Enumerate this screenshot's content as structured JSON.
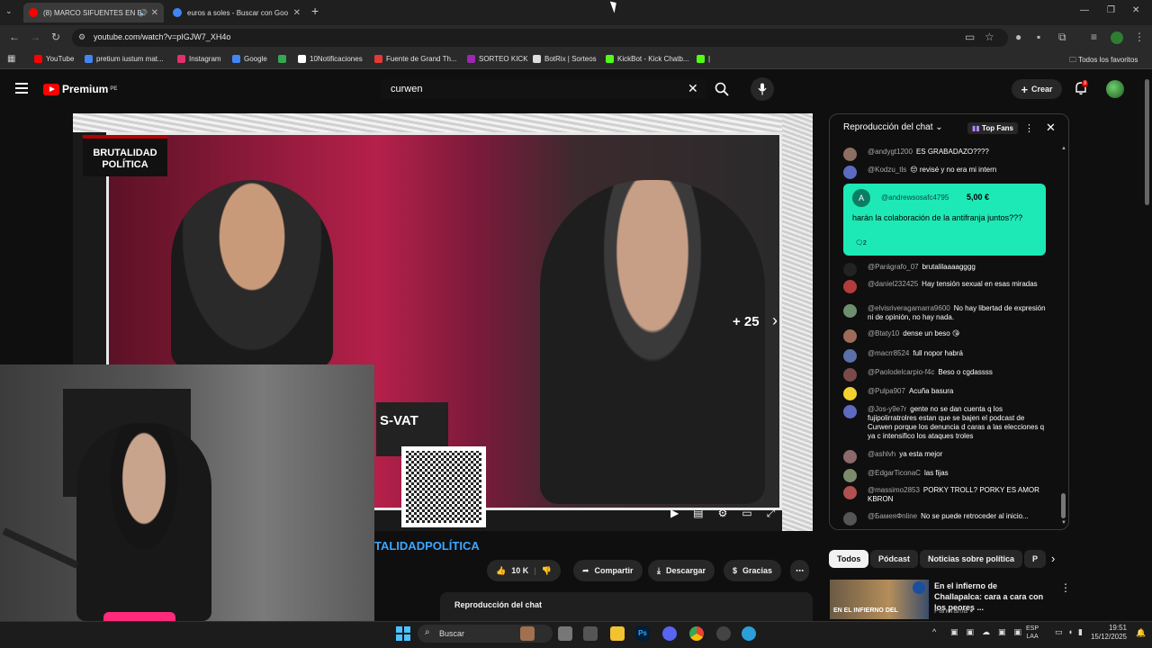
{
  "browser": {
    "tabs": [
      {
        "label": "(8) MARCO SIFUENTES EN B",
        "favicon_color": "#ff0000"
      },
      {
        "label": "euros a soles - Buscar con Goo",
        "favicon_color": "#4285f4"
      }
    ],
    "new_tab": "+",
    "url": "youtube.com/watch?v=pIGJW7_XH4o",
    "bookmarks": [
      {
        "label": "YouTube",
        "color": "#ff0000"
      },
      {
        "label": "pretium iustum mat...",
        "color": "#4285f4"
      },
      {
        "label": "Instagram",
        "color": "#e1306c"
      },
      {
        "label": "Google",
        "color": "#4285f4"
      },
      {
        "label": "",
        "color": "#34a853"
      },
      {
        "label": "10Notificaciones",
        "color": "#ffffff"
      },
      {
        "label": "Fuente de Grand Th...",
        "color": "#e53935"
      },
      {
        "label": "SORTEO KICK",
        "color": "#9c27b0"
      },
      {
        "label": "BotRix | Sorteos",
        "color": "#dddddd"
      },
      {
        "label": "KickBot - Kick Chatb...",
        "color": "#53fc18"
      },
      {
        "label": "|",
        "color": "#53fc18"
      }
    ],
    "all_favorites": "Todos los favoritos"
  },
  "youtube": {
    "logo_text": "Premium",
    "logo_region": "PE",
    "search_value": "curwen",
    "create_label": "Crear",
    "notification_count": "8"
  },
  "video": {
    "logo_text": "BRUTALIDAD POLÍTICA",
    "plus_count": "+ 25",
    "vat_text": "S-VAT"
  },
  "below_video": {
    "channel_name": "TALIDADPOLÍTICA",
    "likes": "10 K",
    "share": "Compartir",
    "download": "Descargar",
    "thanks": "Gracias",
    "chat_replay_title": "Reproducción del chat"
  },
  "chat": {
    "header": "Reproducción del chat",
    "top_fans": "Top Fans",
    "messages_top": [
      {
        "author": "@andygt1200",
        "text": "ES GRABADAZO????",
        "color": "#8d6e63"
      },
      {
        "author": "@Kodzu_tls",
        "text": "😔 revisé y no era mi intern",
        "color": "#5c6bc0"
      }
    ],
    "superchat": {
      "avatar_letter": "A",
      "author": "@andrewsosafc4795",
      "amount": "5,00 €",
      "text": "harán la colaboración de la antifranja juntos???",
      "replies": "2"
    },
    "messages": [
      {
        "author": "@Parágrafo_07",
        "text": "brutalilaaaagggg",
        "color": "#222222"
      },
      {
        "author": "@daniel232425",
        "text": "Hay tensión sexual en esas miradas",
        "color": "#b23b3b"
      },
      {
        "author": "@elvisriveragamarra9600",
        "text": "No hay libertad de expresión ni de opinión, no hay nada.",
        "color": "#6d8f6d"
      },
      {
        "author": "@Btaty10",
        "text": "dense un beso 😘",
        "color": "#9e6b5a"
      },
      {
        "author": "@macrr8524",
        "text": "full nopor habrá",
        "color": "#5b6fa8"
      },
      {
        "author": "@Paolodelcarpio-f4c",
        "text": "Beso o cgdassss",
        "color": "#7a4a4a"
      },
      {
        "author": "@Pulpa907",
        "text": "Acuña basura",
        "color": "#f2d230"
      },
      {
        "author": "@Jos-y9e7r",
        "text": "gente no se dan cuenta q los fujipolirratrolres estan que se bajen el podcast de Curwen porque los denuncia d caras a las elecciones q ya c intensifico los ataques troles",
        "color": "#5c6bc0"
      },
      {
        "author": "@ashlvh",
        "text": "ya esta mejor",
        "color": "#8a6a6a"
      },
      {
        "author": "@EdgarTiconaC",
        "text": "las fijas",
        "color": "#7b8b6b"
      },
      {
        "author": "@massimo2853",
        "text": "PORKY TROLL? PORKY ES AMOR KBRON",
        "color": "#b05050"
      },
      {
        "author": "@БамeяФnline",
        "text": "No se puede retroceder al inicio...",
        "color": "#555555"
      }
    ]
  },
  "chips": [
    "Todos",
    "Pódcast",
    "Noticias sobre política",
    "P"
  ],
  "recommendation": {
    "title": "En el infierno de Challapalca: cara a cara con los peores ...",
    "channel": "Panorama",
    "thumb_text": "EN EL INFIERNO DEL"
  },
  "taskbar": {
    "search_placeholder": "Buscar",
    "lang": "ESP",
    "lang2": "LAA",
    "time": "19:51",
    "date": "15/12/2025"
  }
}
